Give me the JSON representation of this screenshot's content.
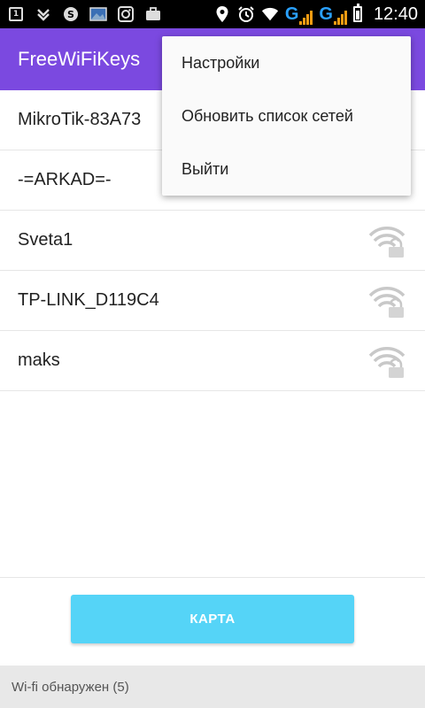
{
  "status_bar": {
    "notification_number": "1",
    "network_type_1": "G",
    "network_type_2": "G",
    "time": "12:40",
    "icons": [
      "sim-icon",
      "download-icon",
      "skype-icon",
      "gallery-icon",
      "instagram-icon",
      "briefcase-icon",
      "location-icon",
      "alarm-icon",
      "wifi-icon",
      "signal-icon",
      "battery-icon"
    ]
  },
  "app_bar": {
    "title": "FreeWiFiKeys",
    "color": "#7b49e0"
  },
  "menu": {
    "items": [
      {
        "label": "Настройки"
      },
      {
        "label": "Обновить список сетей"
      },
      {
        "label": "Выйти"
      }
    ]
  },
  "networks": [
    {
      "name": "MikroTik-83A73",
      "icon": ""
    },
    {
      "name": "-=ARKAD=-",
      "icon": ""
    },
    {
      "name": "Sveta1",
      "icon": "wifi-lock-icon"
    },
    {
      "name": "TP-LINK_D119C4",
      "icon": "wifi-lock-icon"
    },
    {
      "name": "maks",
      "icon": "wifi-lock-icon"
    }
  ],
  "map_button": {
    "label": "КАРТА",
    "color": "#55d4f7"
  },
  "footer": {
    "status": "Wi-fi обнаружен (5)"
  }
}
